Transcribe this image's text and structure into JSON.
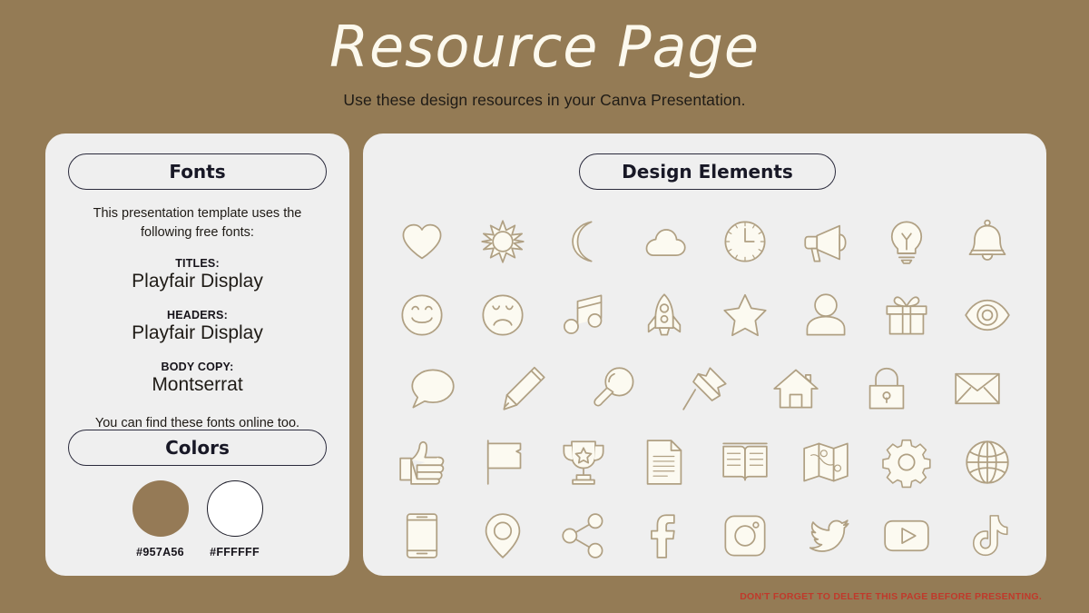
{
  "header": {
    "title": "Resource Page",
    "subtitle": "Use these design resources in your Canva Presentation."
  },
  "fonts_card": {
    "heading": "Fonts",
    "intro": "This presentation template uses the following free fonts:",
    "groups": [
      {
        "role": "TITLES:",
        "name": "Playfair Display"
      },
      {
        "role": "HEADERS:",
        "name": "Playfair Display"
      },
      {
        "role": "BODY COPY:",
        "name": "Montserrat"
      }
    ],
    "outro": "You can find these fonts online too."
  },
  "colors_section": {
    "heading": "Colors",
    "swatches": [
      {
        "hex": "#957A56",
        "label": "#957A56",
        "outlined": false
      },
      {
        "hex": "#FFFFFF",
        "label": "#FFFFFF",
        "outlined": true
      }
    ]
  },
  "elements_card": {
    "heading": "Design Elements",
    "rows": [
      [
        "heart-icon",
        "sun-icon",
        "moon-icon",
        "cloud-icon",
        "clock-icon",
        "megaphone-icon",
        "lightbulb-icon",
        "bell-icon"
      ],
      [
        "smiley-face-icon",
        "sad-face-icon",
        "music-note-icon",
        "rocket-icon",
        "star-icon",
        "person-icon",
        "gift-icon",
        "eye-icon"
      ],
      [
        "speech-bubble-icon",
        "pencil-icon",
        "magnifier-icon",
        "pushpin-icon",
        "house-icon",
        "lock-icon",
        "envelope-icon"
      ],
      [
        "thumbs-up-icon",
        "flag-icon",
        "trophy-icon",
        "document-icon",
        "open-book-icon",
        "map-icon",
        "gear-icon",
        "globe-icon"
      ],
      [
        "phone-icon",
        "location-pin-icon",
        "share-icon",
        "facebook-icon",
        "instagram-icon",
        "twitter-icon",
        "youtube-icon",
        "tiktok-icon"
      ]
    ]
  },
  "footer": {
    "warning": "DON'T FORGET TO DELETE THIS PAGE BEFORE PRESENTING."
  },
  "theme": {
    "background": "#947B55",
    "card_background": "#EFEFEF",
    "title_color": "#FCF9EE",
    "icon_stroke": "#B0A083",
    "icon_fill": "#FCFAF1",
    "warning_color": "#C0392B"
  }
}
